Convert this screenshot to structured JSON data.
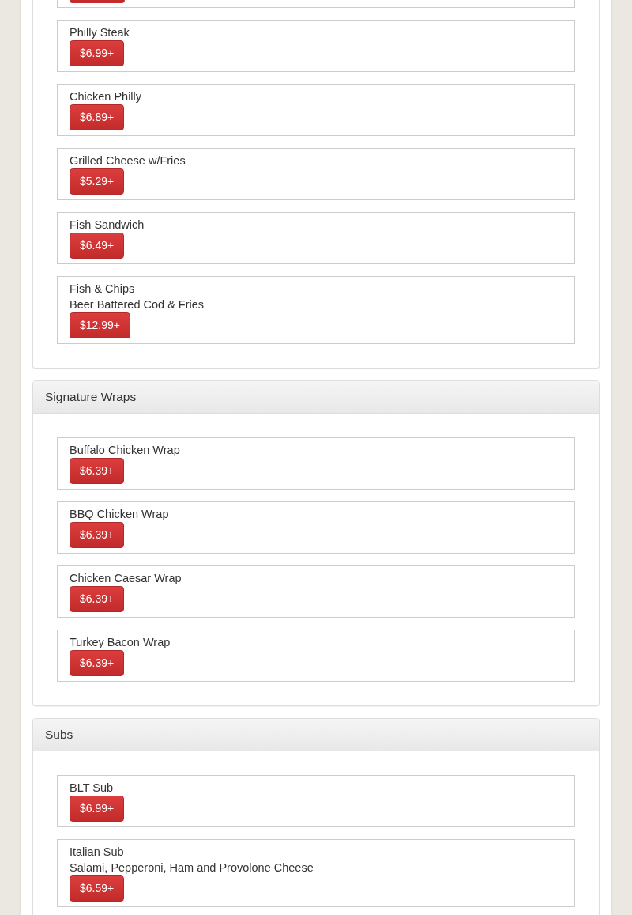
{
  "sections": [
    {
      "kind": "continued",
      "items": [
        {
          "kind": "cut_off"
        },
        {
          "kind": "item",
          "name": "Philly Steak",
          "price": "$6.99+"
        },
        {
          "kind": "item",
          "name": "Chicken Philly",
          "price": "$6.89+"
        },
        {
          "kind": "item",
          "name": "Grilled Cheese w/Fries",
          "price": "$5.29+"
        },
        {
          "kind": "item",
          "name": "Fish Sandwich",
          "price": "$6.49+"
        },
        {
          "kind": "item",
          "name": "Fish & Chips",
          "description": "Beer Battered Cod & Fries",
          "price": "$12.99+"
        }
      ]
    },
    {
      "kind": "full",
      "title": "Signature Wraps",
      "items": [
        {
          "kind": "item",
          "name": "Buffalo Chicken Wrap",
          "price": "$6.39+"
        },
        {
          "kind": "item",
          "name": "BBQ Chicken Wrap",
          "price": "$6.39+"
        },
        {
          "kind": "item",
          "name": "Chicken Caesar Wrap",
          "price": "$6.39+"
        },
        {
          "kind": "item",
          "name": "Turkey Bacon Wrap",
          "price": "$6.39+"
        }
      ]
    },
    {
      "kind": "full",
      "title": "Subs",
      "items": [
        {
          "kind": "item",
          "name": "BLT Sub",
          "price": "$6.99+"
        },
        {
          "kind": "item",
          "name": "Italian Sub",
          "description": "Salami, Pepperoni, Ham and Provolone Cheese",
          "price": "$6.59+"
        }
      ]
    }
  ]
}
